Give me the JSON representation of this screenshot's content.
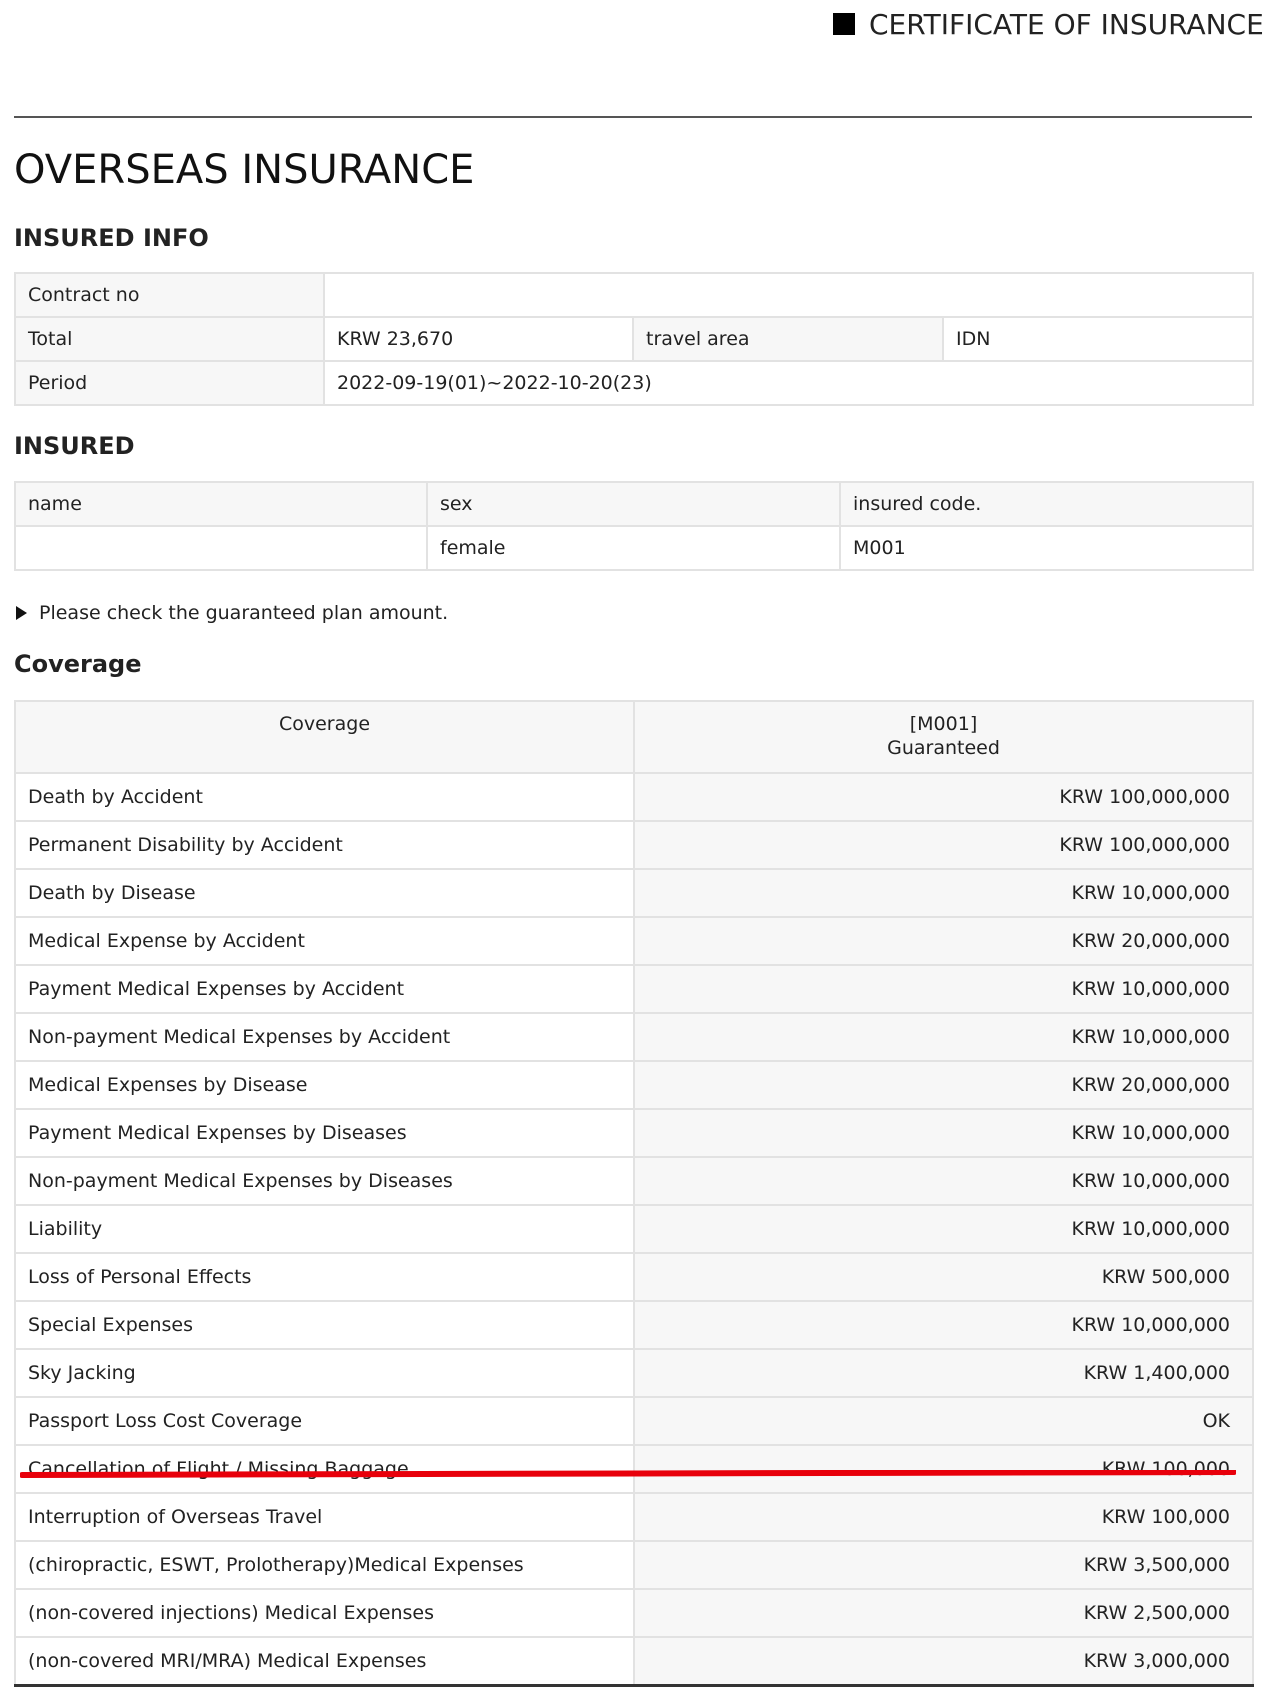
{
  "header": {
    "title": "CERTIFICATE OF INSURANCE"
  },
  "main_title": "OVERSEAS INSURANCE",
  "insured_info": {
    "section_title": "INSURED INFO",
    "contract_no_label": "Contract no",
    "contract_no_value": "",
    "total_label": "Total",
    "total_value": "KRW 23,670",
    "travel_area_label": "travel area",
    "travel_area_value": "IDN",
    "period_label": "Period",
    "period_value": "2022-09-19(01)~2022-10-20(23)"
  },
  "insured": {
    "section_title": "INSURED",
    "headers": [
      "name",
      "sex",
      "insured code."
    ],
    "row": [
      "",
      "female",
      "M001"
    ]
  },
  "notice": "Please check the guaranteed plan amount.",
  "coverage": {
    "section_title": "Coverage",
    "header_coverage": "Coverage",
    "header_code": "[M001]",
    "header_guaranteed": "Guaranteed",
    "rows": [
      {
        "name": "Death by Accident",
        "amount": "KRW 100,000,000"
      },
      {
        "name": "Permanent Disability by Accident",
        "amount": "KRW 100,000,000"
      },
      {
        "name": "Death by Disease",
        "amount": "KRW 10,000,000"
      },
      {
        "name": "Medical Expense by Accident",
        "amount": "KRW 20,000,000"
      },
      {
        "name": "Payment Medical Expenses by Accident",
        "amount": "KRW 10,000,000"
      },
      {
        "name": "Non-payment Medical Expenses by Accident",
        "amount": "KRW 10,000,000"
      },
      {
        "name": "Medical Expenses by Disease",
        "amount": "KRW 20,000,000"
      },
      {
        "name": "Payment Medical Expenses by Diseases",
        "amount": "KRW 10,000,000"
      },
      {
        "name": "Non-payment Medical Expenses by Diseases",
        "amount": "KRW 10,000,000"
      },
      {
        "name": "Liability",
        "amount": "KRW 10,000,000"
      },
      {
        "name": "Loss of Personal Effects",
        "amount": "KRW 500,000"
      },
      {
        "name": "Special Expenses",
        "amount": "KRW 10,000,000"
      },
      {
        "name": "Sky Jacking",
        "amount": "KRW 1,400,000"
      },
      {
        "name": "Passport Loss Cost Coverage",
        "amount": "OK"
      },
      {
        "name": "Cancellation of Flight / Missing Baggage",
        "amount": "KRW 100,000"
      },
      {
        "name": "Interruption of Overseas Travel",
        "amount": "KRW 100,000"
      },
      {
        "name": "(chiropractic, ESWT, Prolotherapy)Medical Expenses",
        "amount": "KRW 3,500,000"
      },
      {
        "name": "(non-covered injections) Medical Expenses",
        "amount": "KRW 2,500,000"
      },
      {
        "name": "(non-covered MRI/MRA) Medical Expenses",
        "amount": "KRW 3,000,000"
      }
    ]
  },
  "colors": {
    "highlight_mark": "#e8000b",
    "border": "#e2e2e2",
    "label_bg": "#f7f7f7"
  }
}
